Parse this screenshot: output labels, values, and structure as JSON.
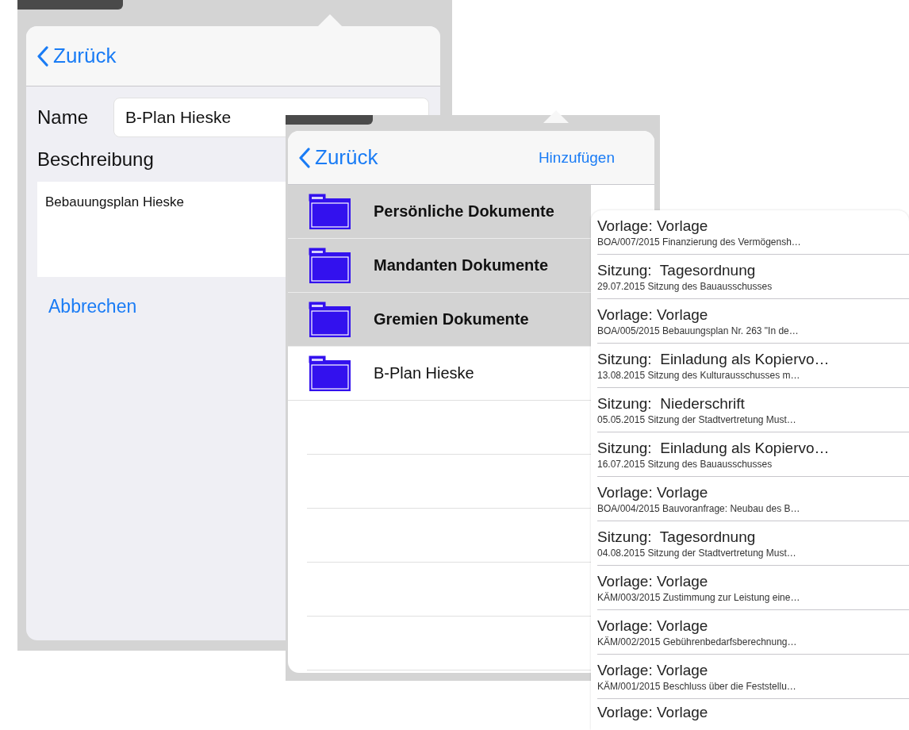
{
  "edit_popover": {
    "back": "Zurück",
    "fields": [
      {
        "label": "Name",
        "value": "B-Plan Hieske"
      }
    ],
    "description": {
      "label": "Beschreibung",
      "value": "Bebauungsplan Hieske"
    },
    "cancel": "Abbrechen"
  },
  "folder_popover": {
    "back": "Zurück",
    "action": "Hinzufügen",
    "folders": [
      {
        "name": "Persönliche Dokumente",
        "selected": true
      },
      {
        "name": "Mandanten Dokumente",
        "selected": true
      },
      {
        "name": "Gremien Dokumente",
        "selected": true
      },
      {
        "name": "B-Plan Hieske",
        "selected": false
      }
    ]
  },
  "document_list": {
    "items": [
      {
        "title": "Vorlage: Vorlage",
        "subtitle": "BOA/007/2015 Finanzierung des Vermögensh…"
      },
      {
        "title": "Sitzung:  Tagesordnung",
        "subtitle": "29.07.2015 Sitzung des Bauausschusses"
      },
      {
        "title": "Vorlage: Vorlage",
        "subtitle": "BOA/005/2015 Bebauungsplan Nr. 263 \"In de…"
      },
      {
        "title": "Sitzung:  Einladung als Kopiervo…",
        "subtitle": "13.08.2015 Sitzung des Kulturausschusses m…"
      },
      {
        "title": "Sitzung:  Niederschrift",
        "subtitle": "05.05.2015 Sitzung der Stadtvertretung Must…"
      },
      {
        "title": "Sitzung:  Einladung als Kopiervo…",
        "subtitle": "16.07.2015 Sitzung des Bauausschusses"
      },
      {
        "title": "Vorlage: Vorlage",
        "subtitle": "BOA/004/2015 Bauvoranfrage: Neubau des B…"
      },
      {
        "title": "Sitzung:  Tagesordnung",
        "subtitle": "04.08.2015 Sitzung der Stadtvertretung Must…"
      },
      {
        "title": "Vorlage: Vorlage",
        "subtitle": "KÄM/003/2015 Zustimmung zur Leistung eine…"
      },
      {
        "title": "Vorlage: Vorlage",
        "subtitle": "KÄM/002/2015 Gebührenbedarfsberechnung…"
      },
      {
        "title": "Vorlage: Vorlage",
        "subtitle": "KÄM/001/2015 Beschluss über die Feststellu…"
      },
      {
        "title": "Vorlage: Vorlage"
      }
    ]
  }
}
